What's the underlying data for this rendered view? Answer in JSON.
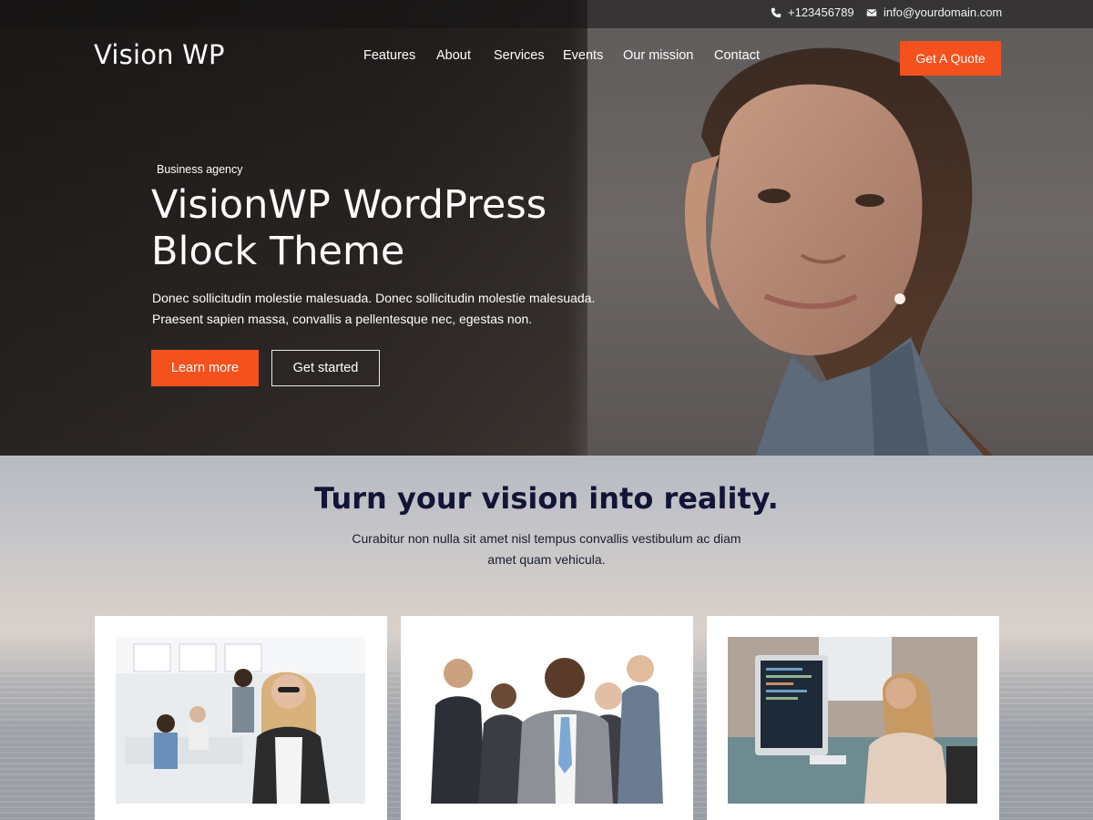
{
  "topbar": {
    "phone": "+123456789",
    "email": "info@yourdomain.com"
  },
  "header": {
    "logo": "Vision WP",
    "nav": [
      "Features",
      "About",
      "Services",
      "Events",
      "Our mission",
      "Contact"
    ],
    "cta": "Get A Quote"
  },
  "hero": {
    "eyebrow": "Business agency",
    "title": "VisionWP WordPress Block Theme",
    "text": "Donec sollicitudin molestie malesuada. Donec sollicitudin molestie malesuada. Praesent sapien massa, convallis a pellentesque nec, egestas non.",
    "primary_button": "Learn more",
    "secondary_button": "Get started"
  },
  "section": {
    "title": "Turn your vision into reality.",
    "text": "Curabitur non nulla sit amet nisl tempus convallis vestibulum ac diam amet quam vehicula."
  },
  "colors": {
    "accent": "#f4511e",
    "heading": "#121538"
  },
  "icons": {
    "phone": "phone-icon",
    "email": "envelope-icon"
  }
}
